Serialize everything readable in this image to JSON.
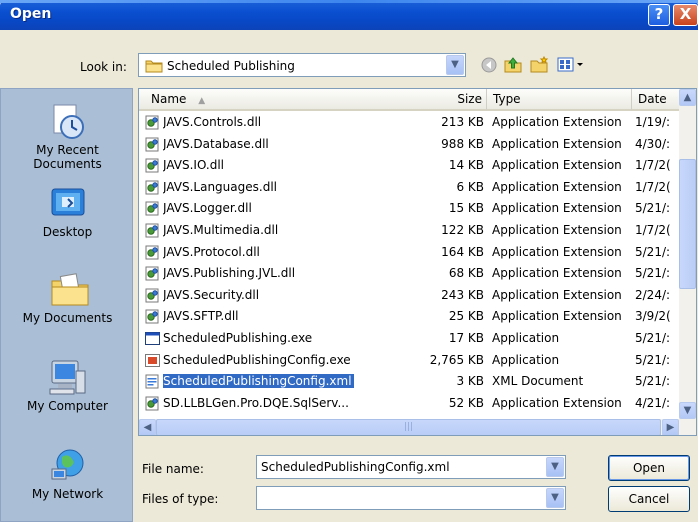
{
  "window": {
    "title": "Open",
    "help": "?",
    "close": "X"
  },
  "lookin": {
    "label": "Look in:",
    "value": "Scheduled Publishing"
  },
  "places": [
    {
      "label": "My Recent\nDocuments"
    },
    {
      "label": "Desktop"
    },
    {
      "label": "My Documents"
    },
    {
      "label": "My Computer"
    },
    {
      "label": "My Network"
    }
  ],
  "columns": {
    "name": "Name",
    "size": "Size",
    "type": "Type",
    "date": "Date"
  },
  "files": [
    {
      "name": "JAVS.Controls.dll",
      "size": "213 KB",
      "type": "Application Extension",
      "date": "1/19/:",
      "icon": "dll"
    },
    {
      "name": "JAVS.Database.dll",
      "size": "988 KB",
      "type": "Application Extension",
      "date": "4/30/:",
      "icon": "dll"
    },
    {
      "name": "JAVS.IO.dll",
      "size": "14 KB",
      "type": "Application Extension",
      "date": "1/7/2(",
      "icon": "dll"
    },
    {
      "name": "JAVS.Languages.dll",
      "size": "6 KB",
      "type": "Application Extension",
      "date": "1/7/2(",
      "icon": "dll"
    },
    {
      "name": "JAVS.Logger.dll",
      "size": "15 KB",
      "type": "Application Extension",
      "date": "5/21/:",
      "icon": "dll"
    },
    {
      "name": "JAVS.Multimedia.dll",
      "size": "122 KB",
      "type": "Application Extension",
      "date": "1/7/2(",
      "icon": "dll"
    },
    {
      "name": "JAVS.Protocol.dll",
      "size": "164 KB",
      "type": "Application Extension",
      "date": "5/21/:",
      "icon": "dll"
    },
    {
      "name": "JAVS.Publishing.JVL.dll",
      "size": "68 KB",
      "type": "Application Extension",
      "date": "5/21/:",
      "icon": "dll"
    },
    {
      "name": "JAVS.Security.dll",
      "size": "243 KB",
      "type": "Application Extension",
      "date": "2/24/:",
      "icon": "dll"
    },
    {
      "name": "JAVS.SFTP.dll",
      "size": "25 KB",
      "type": "Application Extension",
      "date": "3/9/2(",
      "icon": "dll"
    },
    {
      "name": "ScheduledPublishing.exe",
      "size": "17 KB",
      "type": "Application",
      "date": "5/21/:",
      "icon": "exe"
    },
    {
      "name": "ScheduledPublishingConfig.exe",
      "size": "2,765 KB",
      "type": "Application",
      "date": "5/21/:",
      "icon": "exe2"
    },
    {
      "name": "ScheduledPublishingConfig.xml",
      "size": "3 KB",
      "type": "XML Document",
      "date": "5/21/:",
      "icon": "xml",
      "selected": true
    },
    {
      "name": "SD.LLBLGen.Pro.DQE.SqlServ...",
      "size": "52 KB",
      "type": "Application Extension",
      "date": "4/21/:",
      "icon": "dll"
    }
  ],
  "filename": {
    "label": "File name:",
    "value": "ScheduledPublishingConfig.xml"
  },
  "filetype": {
    "label": "Files of type:",
    "value": ""
  },
  "buttons": {
    "open": "Open",
    "cancel": "Cancel"
  }
}
